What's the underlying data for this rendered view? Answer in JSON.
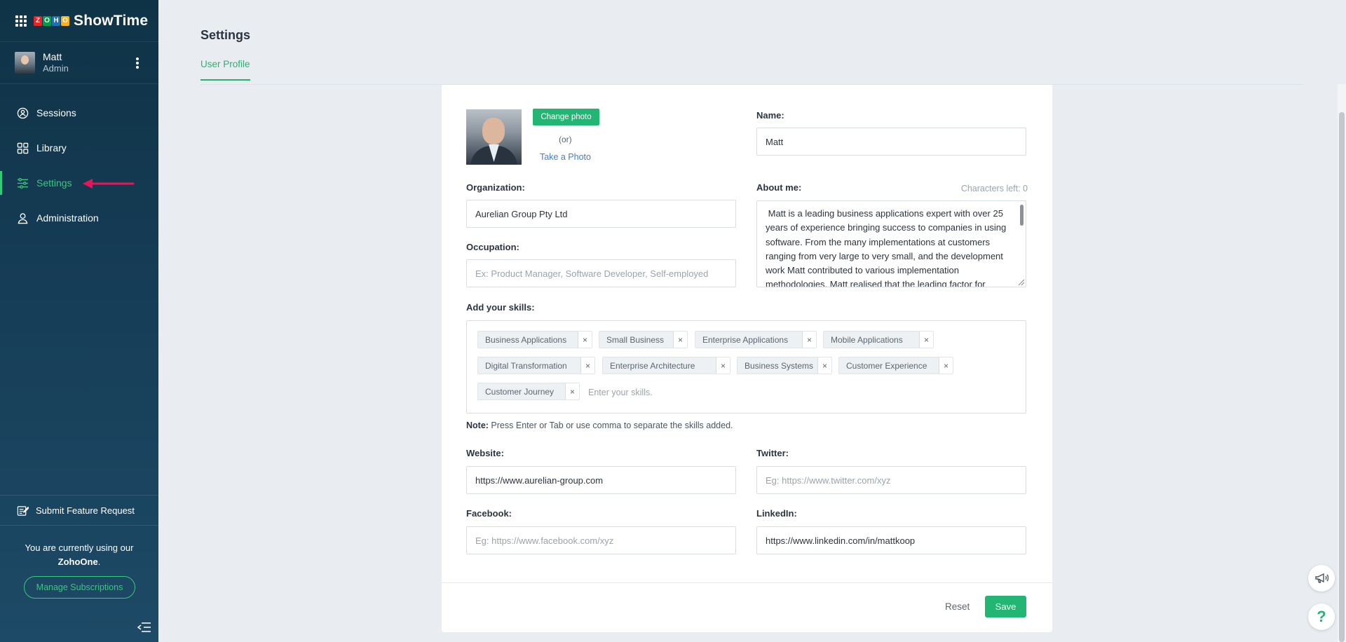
{
  "app": {
    "brand": "ShowTime",
    "zoho_letters": [
      "Z",
      "O",
      "H",
      "O"
    ],
    "zoho_colors": [
      "#e42527",
      "#089949",
      "#226db4",
      "#f9b21d"
    ]
  },
  "user": {
    "name": "Matt",
    "role": "Admin"
  },
  "sidebar": {
    "items": [
      {
        "label": "Sessions",
        "icon": "sessions-icon"
      },
      {
        "label": "Library",
        "icon": "library-icon"
      },
      {
        "label": "Settings",
        "icon": "settings-sliders-icon",
        "active": true
      },
      {
        "label": "Administration",
        "icon": "user-admin-icon"
      }
    ],
    "feature_request": "Submit Feature Request",
    "plan_prefix": "You are currently using our",
    "plan_name": "ZohoOne",
    "manage_label": "Manage Subscriptions"
  },
  "page": {
    "title": "Settings",
    "tab": "User Profile"
  },
  "profile": {
    "change_photo": "Change photo",
    "or": "(or)",
    "take_photo": "Take a Photo",
    "name_label": "Name:",
    "name_value": "Matt",
    "org_label": "Organization:",
    "org_value": "Aurelian Group Pty Ltd",
    "about_label": "About me:",
    "chars_left": "Characters left: 0",
    "about_value": " Matt is a leading business applications expert with over 25 years of experience bringing success to companies in using software. From the many implementations at customers ranging from very large to very small, and the development work Matt contributed to various implementation methodologies, Matt realised that the leading factor for",
    "occupation_label": "Occupation:",
    "occupation_placeholder": "Ex: Product Manager, Software Developer, Self-employed",
    "skills_label": "Add your skills:",
    "skills": [
      "Business Applications",
      "Small Business",
      "Enterprise Applications",
      "Mobile Applications",
      "Digital Transformation",
      "Enterprise Architecture",
      "Business Systems",
      "Customer Experience",
      "Customer Journey"
    ],
    "skills_placeholder": "Enter your skills.",
    "note_bold": "Note:",
    "note_text": " Press Enter or Tab or use comma to separate the skills added.",
    "website_label": "Website:",
    "website_value": "https://www.aurelian-group.com",
    "twitter_label": "Twitter:",
    "twitter_placeholder": "Eg: https://www.twitter.com/xyz",
    "facebook_label": "Facebook:",
    "facebook_placeholder": "Eg: https://www.facebook.com/xyz",
    "linkedin_label": "LinkedIn:",
    "linkedin_value": "https://www.linkedin.com/in/mattkoop",
    "reset": "Reset",
    "save": "Save"
  },
  "floating": {
    "help": "?"
  },
  "colors": {
    "accent": "#22b573",
    "sidebar_bg": "#163d57",
    "annotation_arrow": "#e8145a"
  }
}
